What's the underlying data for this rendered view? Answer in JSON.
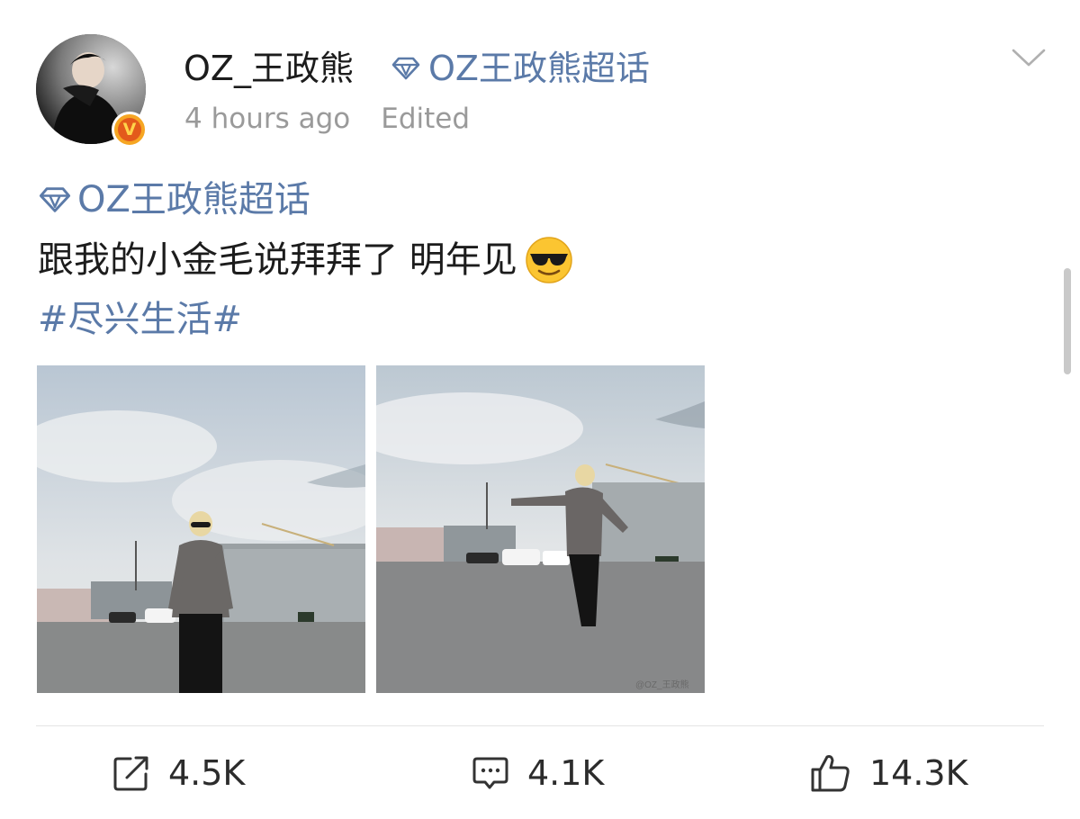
{
  "header": {
    "username": "OZ_王政熊",
    "topic_link": "OZ王政熊超话",
    "timestamp": "4 hours ago",
    "edited_label": "Edited"
  },
  "post": {
    "topic": "OZ王政熊超话",
    "text": "跟我的小金毛说拜拜了 明年见",
    "emoji": "cool-sunglasses-emoji",
    "hashtag": "#尽兴生活#",
    "images": [
      {
        "name": "photo-standing"
      },
      {
        "name": "photo-arms-outstretched",
        "watermark": "@OZ_王政熊"
      }
    ]
  },
  "actions": {
    "repost_count": "4.5K",
    "comment_count": "4.1K",
    "like_count": "14.3K"
  },
  "colors": {
    "link": "#5b7aa8",
    "text": "#1c1c1c",
    "meta": "#9a9a9a",
    "verified_outer": "#f6a623",
    "verified_inner": "#e35a1b"
  }
}
